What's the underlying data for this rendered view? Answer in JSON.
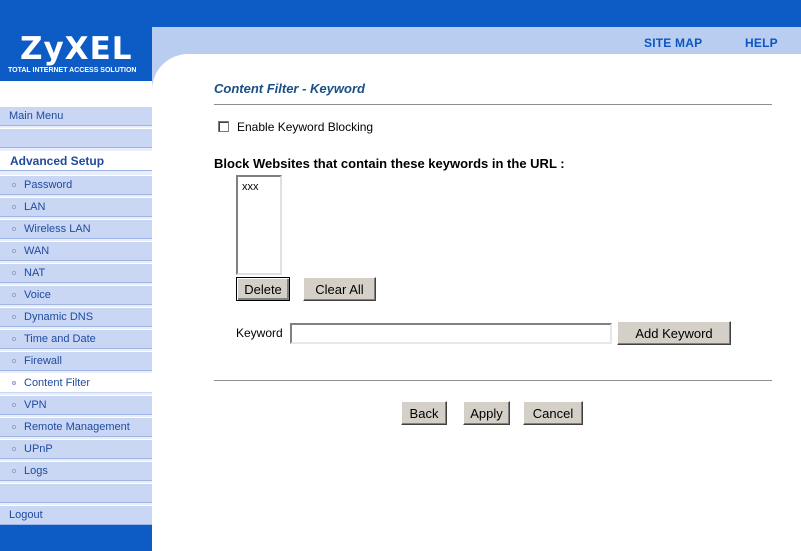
{
  "header": {
    "site_map": "SITE MAP",
    "help": "HELP"
  },
  "logo": {
    "name": "ZyXEL",
    "tagline": "TOTAL INTERNET ACCESS SOLUTION"
  },
  "sidebar": {
    "main_menu": "Main Menu",
    "section_heading": "Advanced Setup",
    "items": [
      {
        "label": "Password"
      },
      {
        "label": "LAN"
      },
      {
        "label": "Wireless LAN"
      },
      {
        "label": "WAN"
      },
      {
        "label": "NAT"
      },
      {
        "label": "Voice"
      },
      {
        "label": "Dynamic DNS"
      },
      {
        "label": "Time and Date"
      },
      {
        "label": "Firewall"
      },
      {
        "label": "Content Filter"
      },
      {
        "label": "VPN"
      },
      {
        "label": "Remote Management"
      },
      {
        "label": "UPnP"
      },
      {
        "label": "Logs"
      }
    ],
    "active_item": "Content Filter",
    "logout": "Logout"
  },
  "page": {
    "title": "Content Filter - Keyword",
    "enable_label": "Enable Keyword Blocking",
    "enable_checked": false,
    "block_label": "Block Websites that contain these keywords in the URL :",
    "keywords": [
      "xxx"
    ],
    "delete_label": "Delete",
    "clear_all_label": "Clear All",
    "keyword_label": "Keyword",
    "keyword_value": "",
    "add_keyword_label": "Add Keyword",
    "back_label": "Back",
    "apply_label": "Apply",
    "cancel_label": "Cancel"
  },
  "colors": {
    "brand_blue": "#0d5cc6",
    "title_blue": "#1a4f85",
    "sidebar_blue": "#c9d7f5"
  }
}
